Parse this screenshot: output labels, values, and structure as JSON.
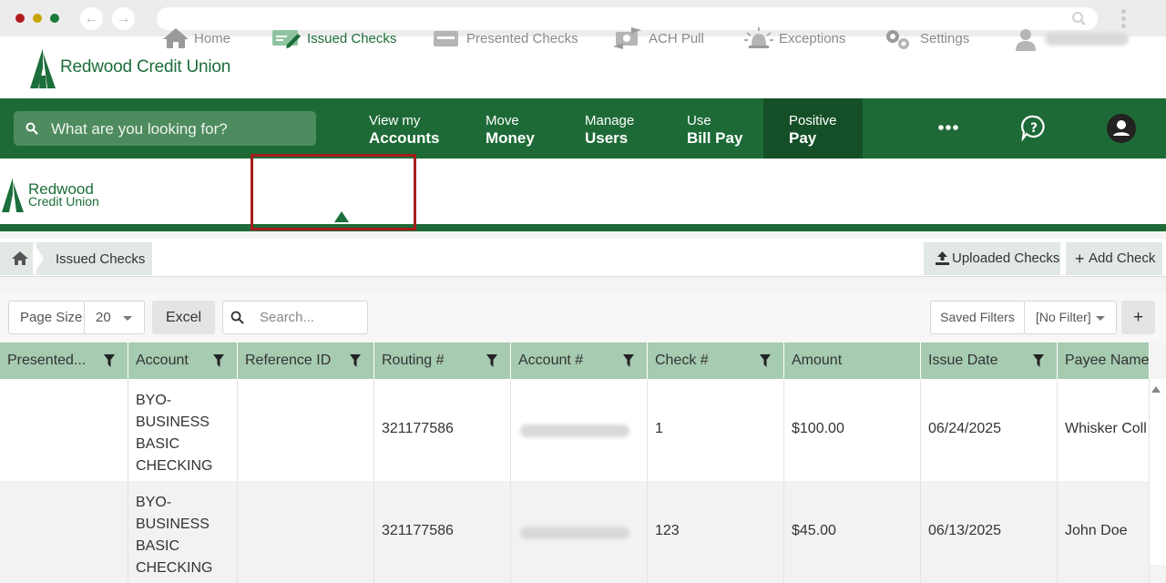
{
  "browser": {
    "window_buttons": [
      {
        "name": "close",
        "color": "#b01c1c"
      },
      {
        "name": "minimize",
        "color": "#c9a400"
      },
      {
        "name": "maximize",
        "color": "#1c7a3a"
      }
    ],
    "back_glyph": "←",
    "forward_glyph": "→"
  },
  "banner": {
    "logo_text": "Redwood Credit Union"
  },
  "navbar": {
    "search_placeholder": "What are you looking for?",
    "items": [
      {
        "line1": "View my",
        "line2": "Accounts"
      },
      {
        "line1": "Move",
        "line2": "Money"
      },
      {
        "line1": "Manage",
        "line2": "Users"
      },
      {
        "line1": "Use",
        "line2": "Bill Pay"
      },
      {
        "line1": "Positive",
        "line2": "Pay",
        "active": true
      }
    ],
    "colors": {
      "bar": "#1d6a36",
      "active": "#154f27",
      "search": "#4e8b5f"
    }
  },
  "subnav": {
    "logo_line1": "Redwood",
    "logo_line2": "Credit Union",
    "items": [
      {
        "label": "Home",
        "icon": "home-icon"
      },
      {
        "label": "Issued Checks",
        "icon": "check-edit-icon",
        "active": true
      },
      {
        "label": "Presented Checks",
        "icon": "card-icon"
      },
      {
        "label": "ACH Pull",
        "icon": "transfer-icon"
      },
      {
        "label": "Exceptions",
        "icon": "alarm-icon"
      },
      {
        "label": "Settings",
        "icon": "gears-icon"
      }
    ]
  },
  "breadcrumb": {
    "current": "Issued Checks"
  },
  "actions": {
    "uploaded": "Uploaded Checks",
    "add": "Add Check"
  },
  "toolbar": {
    "page_size_label": "Page Size",
    "page_size_value": "20",
    "excel": "Excel",
    "search_placeholder": "Search...",
    "saved_filters": "Saved Filters",
    "filter_value": "[No Filter]",
    "add_glyph": "+"
  },
  "table": {
    "columns": [
      "Presented...",
      "Account",
      "Reference ID",
      "Routing #",
      "Account #",
      "Check #",
      "Amount",
      "Issue Date",
      "Payee Name"
    ],
    "rows": [
      {
        "presented": "",
        "account": "BYO-BUSINESS BASIC CHECKING",
        "reference_id": "",
        "routing": "321177586",
        "account_no": "",
        "check_no": "1",
        "amount": "$100.00",
        "issue_date": "06/24/2025",
        "payee": "Whisker Coll"
      },
      {
        "presented": "",
        "account": "BYO-BUSINESS BASIC CHECKING",
        "reference_id": "",
        "routing": "321177586",
        "account_no": "",
        "check_no": "123",
        "amount": "$45.00",
        "issue_date": "06/13/2025",
        "payee": "John Doe"
      }
    ],
    "header_color": "#a6cbb1"
  }
}
